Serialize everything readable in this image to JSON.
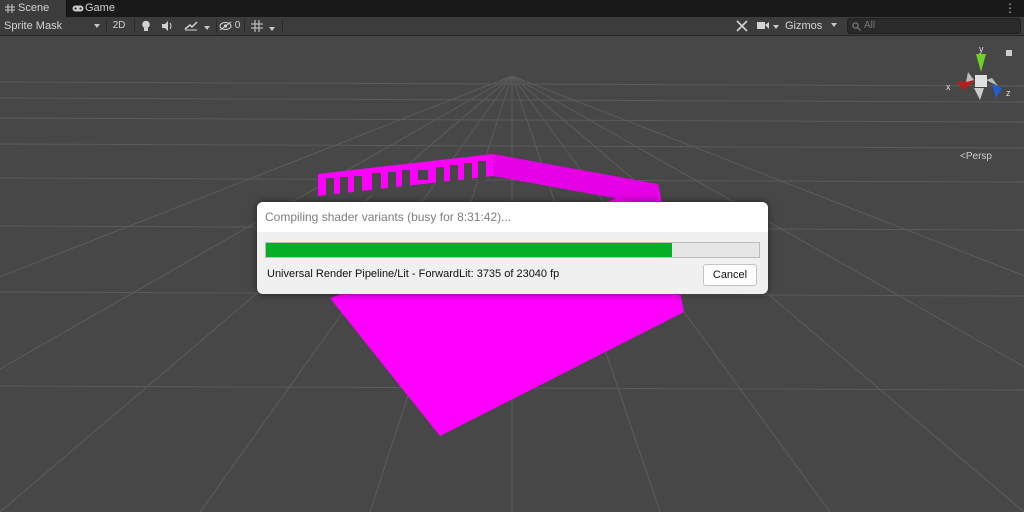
{
  "tabs": [
    {
      "label": "Scene",
      "icon": "grid-icon"
    },
    {
      "label": "Game",
      "icon": "gamepad-icon"
    }
  ],
  "toolbar": {
    "draw_mode": "Sprite Mask",
    "mode_2d": "2D",
    "hidden_count": "0",
    "gizmos_label": "Gizmos",
    "search_placeholder": "All"
  },
  "scene": {
    "persp_label": "Persp",
    "axis_x": "x",
    "axis_y": "y",
    "axis_z": "z",
    "colors": {
      "background": "#474747",
      "grid": "#5c5c5c",
      "mesh": "#ff00ff",
      "mesh_dark": "#d400d4"
    }
  },
  "dialog": {
    "title": "Compiling shader variants (busy for 8:31:42)...",
    "progress": 0.8243,
    "progress_color": "#06b025",
    "status": "Universal Render Pipeline/Lit - ForwardLit: 3735 of 23040 fp",
    "cancel_label": "Cancel"
  }
}
